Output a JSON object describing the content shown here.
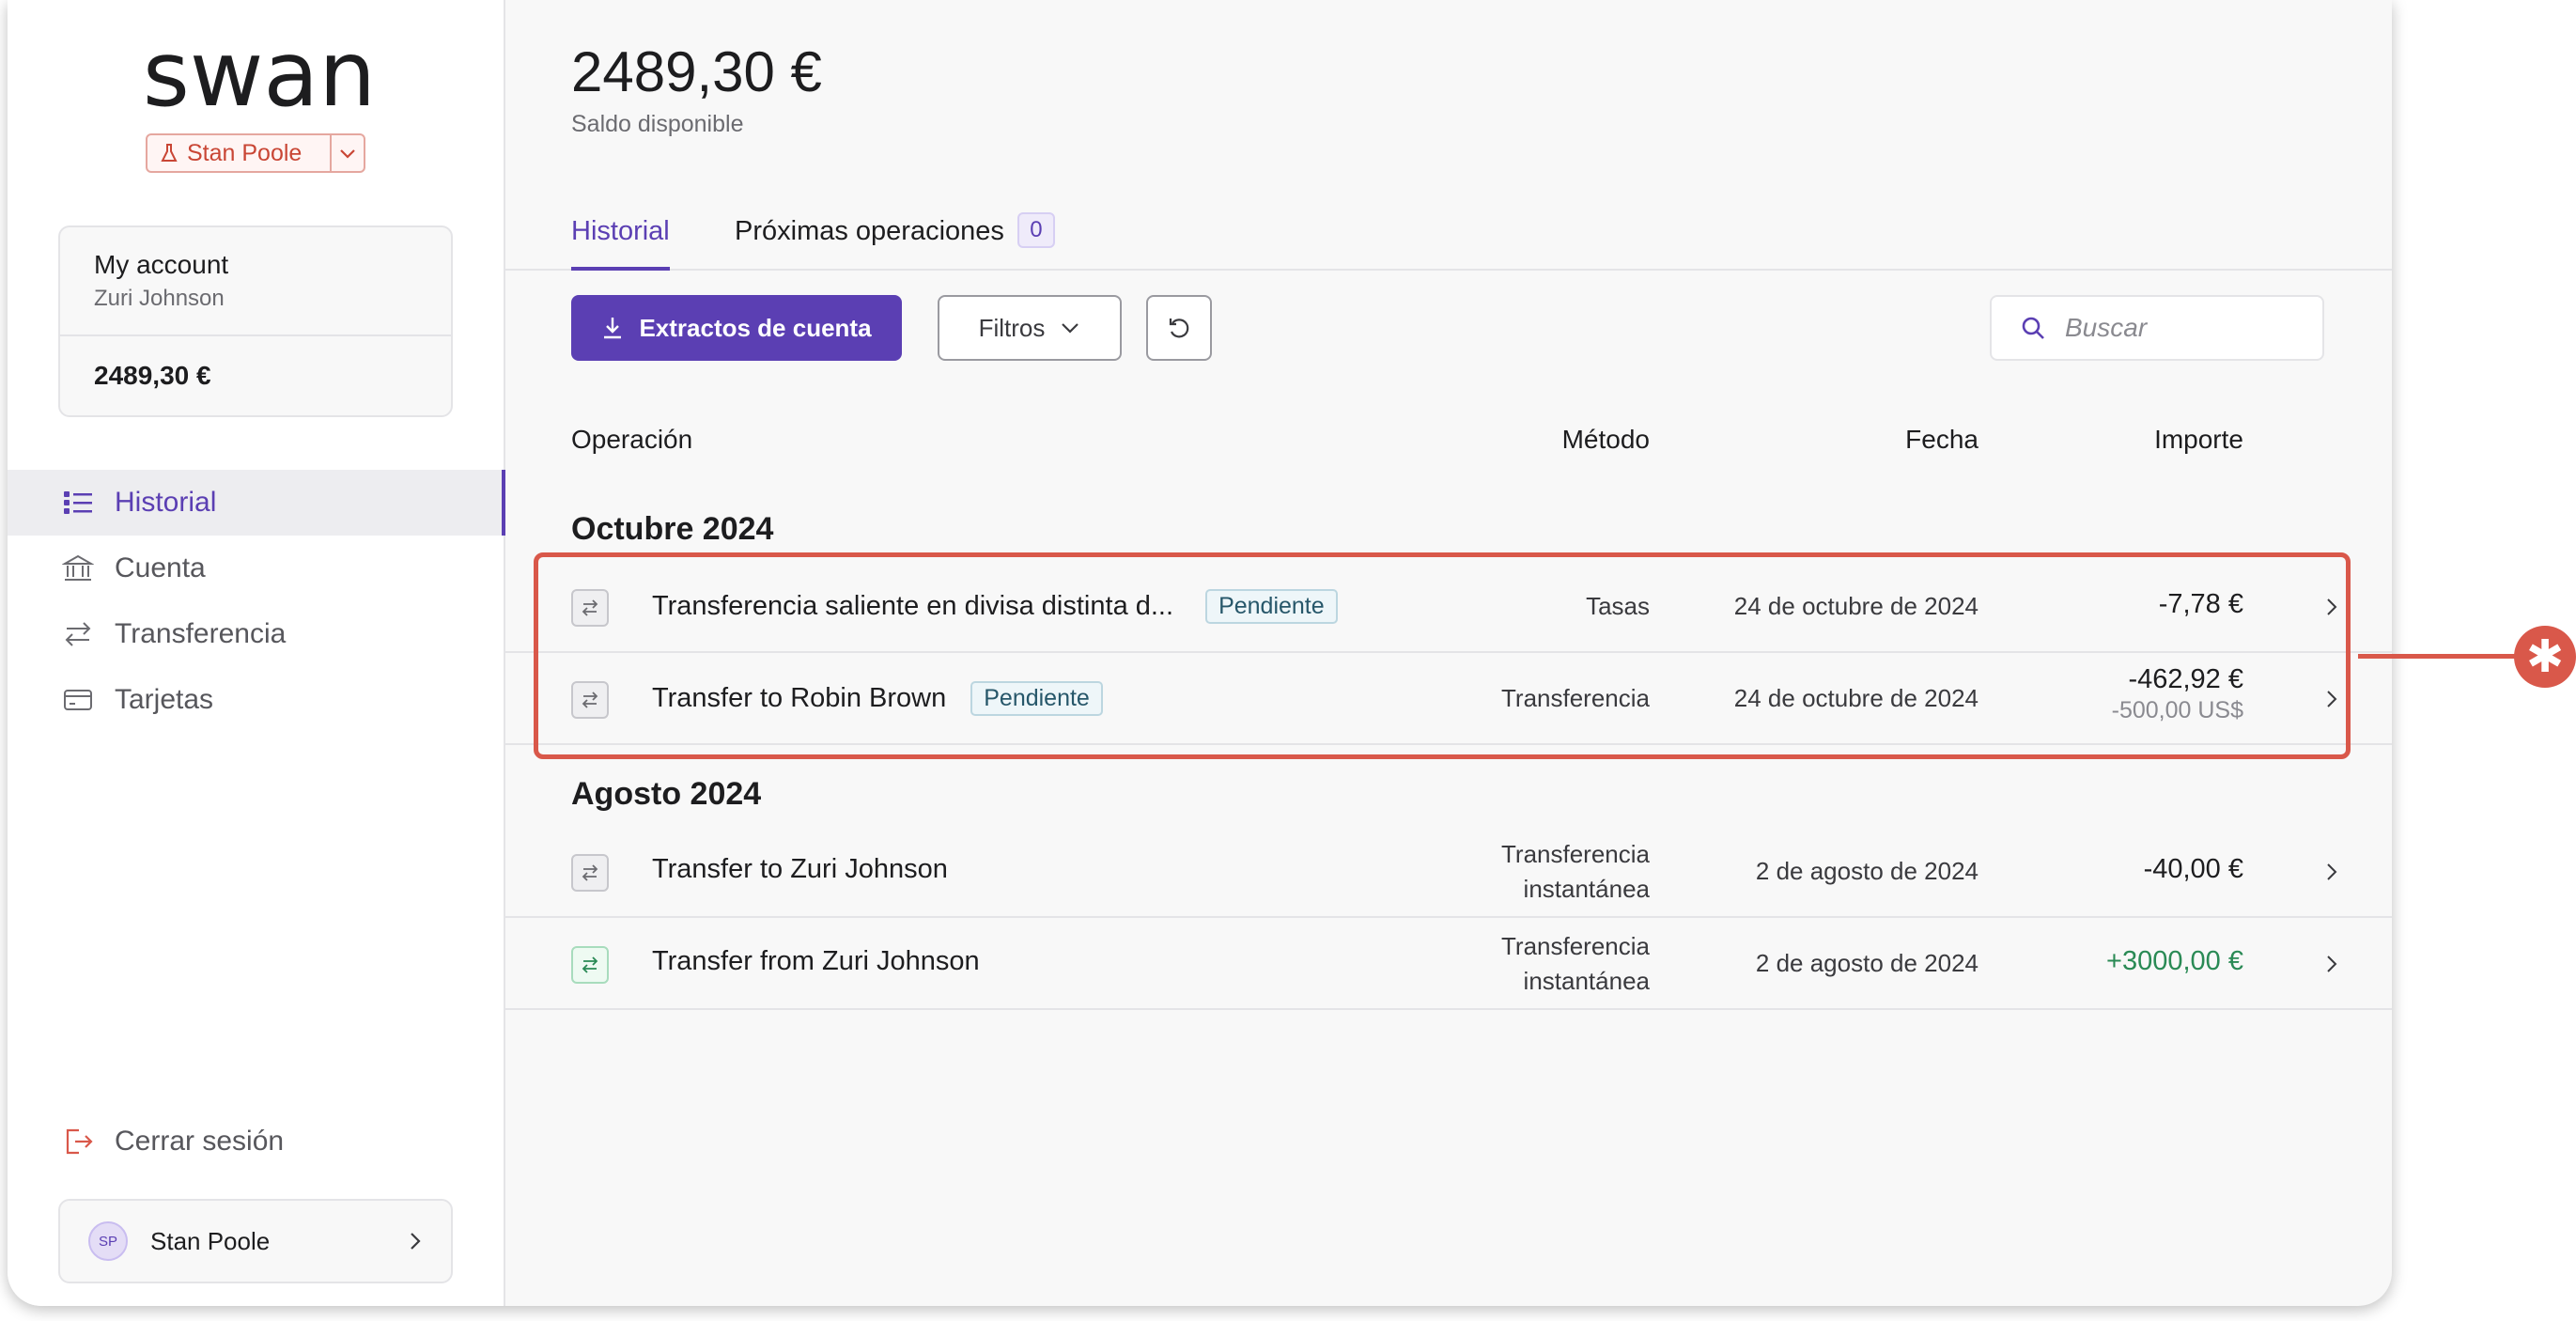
{
  "sidebar": {
    "logo_text": "swan",
    "project_badge": "Stan Poole",
    "account": {
      "name": "My account",
      "holder": "Zuri Johnson",
      "balance": "2489,30 €"
    },
    "nav": [
      {
        "label": "Historial",
        "icon": "list-icon",
        "active": true
      },
      {
        "label": "Cuenta",
        "icon": "bank-icon",
        "active": false
      },
      {
        "label": "Transferencia",
        "icon": "transfer-icon",
        "active": false
      },
      {
        "label": "Tarjetas",
        "icon": "card-icon",
        "active": false
      }
    ],
    "logout_label": "Cerrar sesión",
    "user": {
      "initials": "SP",
      "name": "Stan Poole"
    }
  },
  "header": {
    "balance": "2489,30 €",
    "balance_label": "Saldo disponible"
  },
  "tabs": [
    {
      "label": "Historial",
      "active": true
    },
    {
      "label": "Próximas operaciones",
      "count": "0"
    }
  ],
  "toolbar": {
    "statements_label": "Extractos de cuenta",
    "filters_label": "Filtros",
    "search_placeholder": "Buscar"
  },
  "table": {
    "columns": [
      "Operación",
      "Método",
      "Fecha",
      "Importe"
    ],
    "groups": [
      {
        "title": "Octubre 2024",
        "rows": [
          {
            "operation": "Transferencia saliente en divisa distinta d...",
            "status": "Pendiente",
            "method": "Tasas",
            "date": "24 de octubre de 2024",
            "amount": "-7,78 €"
          },
          {
            "operation": "Transfer to Robin Brown",
            "status": "Pendiente",
            "method": "Transferencia",
            "date": "24 de octubre de 2024",
            "amount": "-462,92 €",
            "original_amount": "-500,00 US$"
          }
        ]
      },
      {
        "title": "Agosto 2024",
        "rows": [
          {
            "operation": "Transfer to Zuri Johnson",
            "method_line1": "Transferencia",
            "method_line2": "instantánea",
            "date": "2 de agosto de 2024",
            "amount": "-40,00 €"
          },
          {
            "operation": "Transfer from Zuri Johnson",
            "method_line1": "Transferencia",
            "method_line2": "instantánea",
            "date": "2 de agosto de 2024",
            "amount": "+3000,00 €"
          }
        ]
      }
    ]
  },
  "colors": {
    "accent": "#5b3fb3",
    "positive": "#2a8a55",
    "highlight": "#d9584a"
  }
}
